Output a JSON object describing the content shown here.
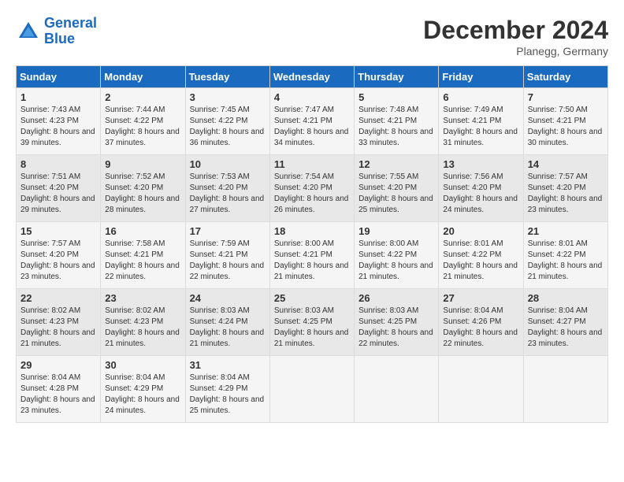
{
  "header": {
    "logo_line1": "General",
    "logo_line2": "Blue",
    "month": "December 2024",
    "location": "Planegg, Germany"
  },
  "days_of_week": [
    "Sunday",
    "Monday",
    "Tuesday",
    "Wednesday",
    "Thursday",
    "Friday",
    "Saturday"
  ],
  "weeks": [
    [
      {
        "day": 1,
        "sunrise": "7:43 AM",
        "sunset": "4:23 PM",
        "daylight": "8 hours and 39 minutes."
      },
      {
        "day": 2,
        "sunrise": "7:44 AM",
        "sunset": "4:22 PM",
        "daylight": "8 hours and 37 minutes."
      },
      {
        "day": 3,
        "sunrise": "7:45 AM",
        "sunset": "4:22 PM",
        "daylight": "8 hours and 36 minutes."
      },
      {
        "day": 4,
        "sunrise": "7:47 AM",
        "sunset": "4:21 PM",
        "daylight": "8 hours and 34 minutes."
      },
      {
        "day": 5,
        "sunrise": "7:48 AM",
        "sunset": "4:21 PM",
        "daylight": "8 hours and 33 minutes."
      },
      {
        "day": 6,
        "sunrise": "7:49 AM",
        "sunset": "4:21 PM",
        "daylight": "8 hours and 31 minutes."
      },
      {
        "day": 7,
        "sunrise": "7:50 AM",
        "sunset": "4:21 PM",
        "daylight": "8 hours and 30 minutes."
      }
    ],
    [
      {
        "day": 8,
        "sunrise": "7:51 AM",
        "sunset": "4:20 PM",
        "daylight": "8 hours and 29 minutes."
      },
      {
        "day": 9,
        "sunrise": "7:52 AM",
        "sunset": "4:20 PM",
        "daylight": "8 hours and 28 minutes."
      },
      {
        "day": 10,
        "sunrise": "7:53 AM",
        "sunset": "4:20 PM",
        "daylight": "8 hours and 27 minutes."
      },
      {
        "day": 11,
        "sunrise": "7:54 AM",
        "sunset": "4:20 PM",
        "daylight": "8 hours and 26 minutes."
      },
      {
        "day": 12,
        "sunrise": "7:55 AM",
        "sunset": "4:20 PM",
        "daylight": "8 hours and 25 minutes."
      },
      {
        "day": 13,
        "sunrise": "7:56 AM",
        "sunset": "4:20 PM",
        "daylight": "8 hours and 24 minutes."
      },
      {
        "day": 14,
        "sunrise": "7:57 AM",
        "sunset": "4:20 PM",
        "daylight": "8 hours and 23 minutes."
      }
    ],
    [
      {
        "day": 15,
        "sunrise": "7:57 AM",
        "sunset": "4:20 PM",
        "daylight": "8 hours and 23 minutes."
      },
      {
        "day": 16,
        "sunrise": "7:58 AM",
        "sunset": "4:21 PM",
        "daylight": "8 hours and 22 minutes."
      },
      {
        "day": 17,
        "sunrise": "7:59 AM",
        "sunset": "4:21 PM",
        "daylight": "8 hours and 22 minutes."
      },
      {
        "day": 18,
        "sunrise": "8:00 AM",
        "sunset": "4:21 PM",
        "daylight": "8 hours and 21 minutes."
      },
      {
        "day": 19,
        "sunrise": "8:00 AM",
        "sunset": "4:22 PM",
        "daylight": "8 hours and 21 minutes."
      },
      {
        "day": 20,
        "sunrise": "8:01 AM",
        "sunset": "4:22 PM",
        "daylight": "8 hours and 21 minutes."
      },
      {
        "day": 21,
        "sunrise": "8:01 AM",
        "sunset": "4:22 PM",
        "daylight": "8 hours and 21 minutes."
      }
    ],
    [
      {
        "day": 22,
        "sunrise": "8:02 AM",
        "sunset": "4:23 PM",
        "daylight": "8 hours and 21 minutes."
      },
      {
        "day": 23,
        "sunrise": "8:02 AM",
        "sunset": "4:23 PM",
        "daylight": "8 hours and 21 minutes."
      },
      {
        "day": 24,
        "sunrise": "8:03 AM",
        "sunset": "4:24 PM",
        "daylight": "8 hours and 21 minutes."
      },
      {
        "day": 25,
        "sunrise": "8:03 AM",
        "sunset": "4:25 PM",
        "daylight": "8 hours and 21 minutes."
      },
      {
        "day": 26,
        "sunrise": "8:03 AM",
        "sunset": "4:25 PM",
        "daylight": "8 hours and 22 minutes."
      },
      {
        "day": 27,
        "sunrise": "8:04 AM",
        "sunset": "4:26 PM",
        "daylight": "8 hours and 22 minutes."
      },
      {
        "day": 28,
        "sunrise": "8:04 AM",
        "sunset": "4:27 PM",
        "daylight": "8 hours and 23 minutes."
      }
    ],
    [
      {
        "day": 29,
        "sunrise": "8:04 AM",
        "sunset": "4:28 PM",
        "daylight": "8 hours and 23 minutes."
      },
      {
        "day": 30,
        "sunrise": "8:04 AM",
        "sunset": "4:29 PM",
        "daylight": "8 hours and 24 minutes."
      },
      {
        "day": 31,
        "sunrise": "8:04 AM",
        "sunset": "4:29 PM",
        "daylight": "8 hours and 25 minutes."
      },
      null,
      null,
      null,
      null
    ]
  ]
}
